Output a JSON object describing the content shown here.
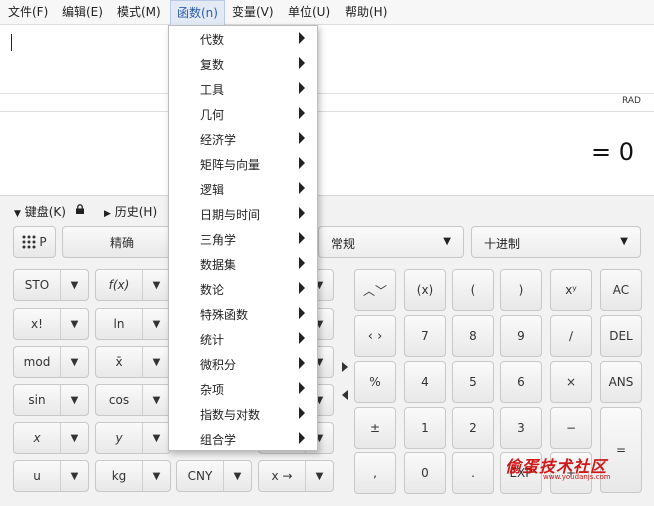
{
  "menubar": {
    "items": [
      "文件(F)",
      "编辑(E)",
      "模式(M)",
      "函数(n)",
      "变量(V)",
      "单位(U)",
      "帮助(H)"
    ],
    "active": "函数(n)"
  },
  "status": {
    "angle_mode": "RAD",
    "result": "= 0"
  },
  "toolbar": {
    "keypad_toggle": "键盘(K)",
    "history_toggle": "历史(H)",
    "grid_button_label": "P",
    "precision_button": "精确",
    "format_combo": "常规",
    "base_combo": "十进制"
  },
  "functions_menu": {
    "items": [
      "代数",
      "复数",
      "工具",
      "几何",
      "经济学",
      "矩阵与向量",
      "逻辑",
      "日期与时间",
      "三角学",
      "数据集",
      "数论",
      "特殊函数",
      "统计",
      "微积分",
      "杂项",
      "指数与对数",
      "组合学"
    ]
  },
  "left_keys": {
    "col1": [
      "STO",
      "x!",
      "mod",
      "sin",
      "x",
      "u"
    ],
    "col2": [
      "f(x)",
      "ln",
      "x̄",
      "cos",
      "y",
      "kg"
    ],
    "col3_bottom": "CNY",
    "col4_bottom": "x →"
  },
  "numpad": {
    "r1": [
      "(x)",
      "(",
      ")",
      "xʸ",
      "AC"
    ],
    "r2": [
      "7",
      "8",
      "9",
      "∕",
      "DEL"
    ],
    "r3": [
      "%",
      "4",
      "5",
      "6",
      "×",
      "ANS"
    ],
    "r4": [
      "±",
      "1",
      "2",
      "3",
      "−",
      "="
    ],
    "r5": [
      ",",
      "0",
      ".",
      "EXP",
      "+"
    ]
  },
  "watermark": {
    "title": "偷蛋技术社区",
    "sub": "www.youdanjs.com"
  }
}
